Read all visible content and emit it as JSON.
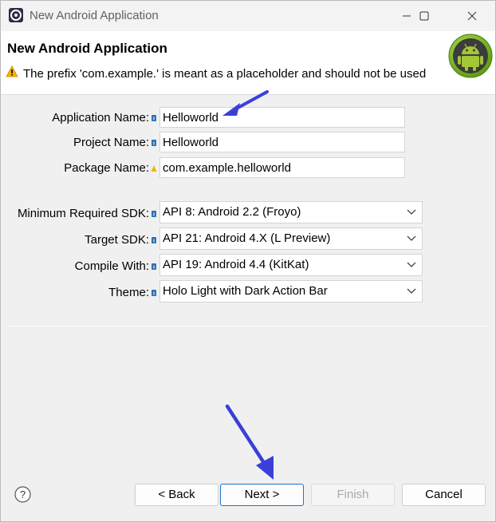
{
  "window": {
    "title": "New Android Application",
    "icon": "eclipse-icon",
    "controls": [
      "minimize-icon",
      "maximize-icon",
      "close-icon"
    ]
  },
  "header": {
    "title": "New Android Application",
    "message": "The prefix 'com.example.' is meant as a placeholder and should not be used",
    "message_icon": "warning-icon",
    "logo": "android-logo"
  },
  "form": {
    "app_name_label": "Application Name:",
    "app_name_value": "Helloworld",
    "project_name_label": "Project Name:",
    "project_name_value": "Helloworld",
    "package_name_label": "Package Name:",
    "package_name_value": "com.example.helloworld",
    "min_sdk_label": "Minimum Required SDK:",
    "min_sdk_value": "API 8: Android 2.2 (Froyo)",
    "target_sdk_label": "Target SDK:",
    "target_sdk_value": "API 21: Android 4.X (L Preview)",
    "compile_with_label": "Compile With:",
    "compile_with_value": "API 19: Android 4.4 (KitKat)",
    "theme_label": "Theme:",
    "theme_value": "Holo Light with Dark Action Bar"
  },
  "buttons": {
    "help": "?",
    "back": "< Back",
    "next": "Next >",
    "finish": "Finish",
    "cancel": "Cancel"
  },
  "colors": {
    "annotation_arrow": "#3b3fd8",
    "warning": "#f5b400",
    "android_green": "#8dc63f"
  }
}
